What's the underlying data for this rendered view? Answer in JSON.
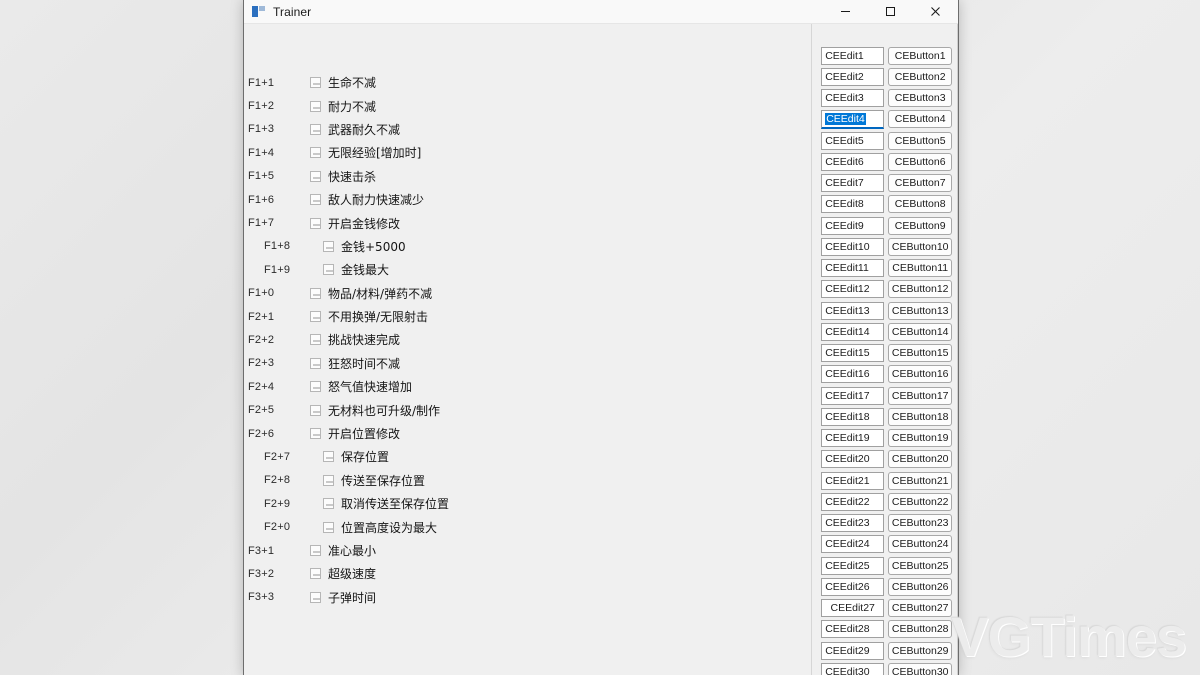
{
  "window": {
    "title": "Trainer",
    "icon": "app-icon",
    "controls": {
      "minimize": "minimize-icon",
      "maximize": "maximize-icon",
      "close": "close-icon"
    }
  },
  "watermark": "VGTimes",
  "cheats": [
    {
      "hotkey": "F1+1",
      "label": "生命不减",
      "indent": false,
      "checked": false
    },
    {
      "hotkey": "F1+2",
      "label": "耐力不减",
      "indent": false,
      "checked": false
    },
    {
      "hotkey": "F1+3",
      "label": "武器耐久不减",
      "indent": false,
      "checked": false
    },
    {
      "hotkey": "F1+4",
      "label": "无限经验[增加时]",
      "indent": false,
      "checked": false
    },
    {
      "hotkey": "F1+5",
      "label": "快速击杀",
      "indent": false,
      "checked": false
    },
    {
      "hotkey": "F1+6",
      "label": "敌人耐力快速减少",
      "indent": false,
      "checked": false
    },
    {
      "hotkey": "F1+7",
      "label": "开启金钱修改",
      "indent": false,
      "checked": false
    },
    {
      "hotkey": "F1+8",
      "label": "金钱+5000",
      "indent": true,
      "checked": false
    },
    {
      "hotkey": "F1+9",
      "label": "金钱最大",
      "indent": true,
      "checked": false
    },
    {
      "hotkey": "F1+0",
      "label": "物品/材料/弹药不减",
      "indent": false,
      "checked": false
    },
    {
      "hotkey": "F2+1",
      "label": "不用换弹/无限射击",
      "indent": false,
      "checked": false
    },
    {
      "hotkey": "F2+2",
      "label": "挑战快速完成",
      "indent": false,
      "checked": false
    },
    {
      "hotkey": "F2+3",
      "label": "狂怒时间不减",
      "indent": false,
      "checked": false
    },
    {
      "hotkey": "F2+4",
      "label": "怒气值快速增加",
      "indent": false,
      "checked": false
    },
    {
      "hotkey": "F2+5",
      "label": "无材料也可升级/制作",
      "indent": false,
      "checked": false
    },
    {
      "hotkey": "F2+6",
      "label": "开启位置修改",
      "indent": false,
      "checked": false
    },
    {
      "hotkey": "F2+7",
      "label": "保存位置",
      "indent": true,
      "checked": false
    },
    {
      "hotkey": "F2+8",
      "label": "传送至保存位置",
      "indent": true,
      "checked": false
    },
    {
      "hotkey": "F2+9",
      "label": "取消传送至保存位置",
      "indent": true,
      "checked": false
    },
    {
      "hotkey": "F2+0",
      "label": "位置高度设为最大",
      "indent": true,
      "checked": false
    },
    {
      "hotkey": "F3+1",
      "label": "准心最小",
      "indent": false,
      "checked": false
    },
    {
      "hotkey": "F3+2",
      "label": "超级速度",
      "indent": false,
      "checked": false
    },
    {
      "hotkey": "F3+3",
      "label": "子弹时间",
      "indent": false,
      "checked": false
    }
  ],
  "ce_rows": [
    {
      "edit": "CEEdit1",
      "button": "CEButton1",
      "focused": false,
      "centered": false
    },
    {
      "edit": "CEEdit2",
      "button": "CEButton2",
      "focused": false,
      "centered": false
    },
    {
      "edit": "CEEdit3",
      "button": "CEButton3",
      "focused": false,
      "centered": false
    },
    {
      "edit": "CEEdit4",
      "button": "CEButton4",
      "focused": true,
      "centered": false
    },
    {
      "edit": "CEEdit5",
      "button": "CEButton5",
      "focused": false,
      "centered": false
    },
    {
      "edit": "CEEdit6",
      "button": "CEButton6",
      "focused": false,
      "centered": false
    },
    {
      "edit": "CEEdit7",
      "button": "CEButton7",
      "focused": false,
      "centered": false
    },
    {
      "edit": "CEEdit8",
      "button": "CEButton8",
      "focused": false,
      "centered": false
    },
    {
      "edit": "CEEdit9",
      "button": "CEButton9",
      "focused": false,
      "centered": false
    },
    {
      "edit": "CEEdit10",
      "button": "CEButton10",
      "focused": false,
      "centered": false
    },
    {
      "edit": "CEEdit11",
      "button": "CEButton11",
      "focused": false,
      "centered": false
    },
    {
      "edit": "CEEdit12",
      "button": "CEButton12",
      "focused": false,
      "centered": false
    },
    {
      "edit": "CEEdit13",
      "button": "CEButton13",
      "focused": false,
      "centered": false
    },
    {
      "edit": "CEEdit14",
      "button": "CEButton14",
      "focused": false,
      "centered": false
    },
    {
      "edit": "CEEdit15",
      "button": "CEButton15",
      "focused": false,
      "centered": false
    },
    {
      "edit": "CEEdit16",
      "button": "CEButton16",
      "focused": false,
      "centered": false
    },
    {
      "edit": "CEEdit17",
      "button": "CEButton17",
      "focused": false,
      "centered": false
    },
    {
      "edit": "CEEdit18",
      "button": "CEButton18",
      "focused": false,
      "centered": false
    },
    {
      "edit": "CEEdit19",
      "button": "CEButton19",
      "focused": false,
      "centered": false
    },
    {
      "edit": "CEEdit20",
      "button": "CEButton20",
      "focused": false,
      "centered": false
    },
    {
      "edit": "CEEdit21",
      "button": "CEButton21",
      "focused": false,
      "centered": false
    },
    {
      "edit": "CEEdit22",
      "button": "CEButton22",
      "focused": false,
      "centered": false
    },
    {
      "edit": "CEEdit23",
      "button": "CEButton23",
      "focused": false,
      "centered": false
    },
    {
      "edit": "CEEdit24",
      "button": "CEButton24",
      "focused": false,
      "centered": false
    },
    {
      "edit": "CEEdit25",
      "button": "CEButton25",
      "focused": false,
      "centered": false
    },
    {
      "edit": "CEEdit26",
      "button": "CEButton26",
      "focused": false,
      "centered": false
    },
    {
      "edit": "CEEdit27",
      "button": "CEButton27",
      "focused": false,
      "centered": true
    },
    {
      "edit": "CEEdit28",
      "button": "CEButton28",
      "focused": false,
      "centered": false
    },
    {
      "edit": "CEEdit29",
      "button": "CEButton29",
      "focused": false,
      "centered": false
    },
    {
      "edit": "CEEdit30",
      "button": "CEButton30",
      "focused": false,
      "centered": false
    }
  ]
}
